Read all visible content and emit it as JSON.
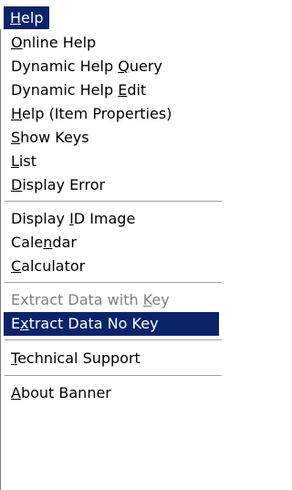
{
  "menu_title": "Help",
  "menu_title_mnemonic": "H",
  "items": [
    {
      "pre": "",
      "u": "O",
      "post": "nline Help",
      "state": "normal"
    },
    {
      "pre": "Dynamic Help ",
      "u": "Q",
      "post": "uery",
      "state": "normal"
    },
    {
      "pre": "Dynamic Help ",
      "u": "E",
      "post": "dit",
      "state": "normal"
    },
    {
      "pre": "",
      "u": "H",
      "post": "elp (Item Properties)",
      "state": "normal"
    },
    {
      "pre": "",
      "u": "S",
      "post": "how Keys",
      "state": "normal"
    },
    {
      "pre": "",
      "u": "L",
      "post": "ist",
      "state": "normal"
    },
    {
      "pre": "",
      "u": "D",
      "post": "isplay Error",
      "state": "normal"
    },
    {
      "pre": "Display ",
      "u": "I",
      "post": "D Image",
      "state": "normal"
    },
    {
      "pre": "Cale",
      "u": "n",
      "post": "dar",
      "state": "normal"
    },
    {
      "pre": "",
      "u": "C",
      "post": "alculator",
      "state": "normal"
    },
    {
      "pre": "Extract Data with ",
      "u": "K",
      "post": "ey",
      "state": "disabled"
    },
    {
      "pre": "E",
      "u": "x",
      "post": "tract Data No Key",
      "state": "highlighted"
    },
    {
      "pre": "",
      "u": "T",
      "post": "echnical Support",
      "state": "normal"
    },
    {
      "pre": "",
      "u": "A",
      "post": "bout Banner",
      "state": "normal"
    }
  ],
  "colors": {
    "highlight_bg": "#0a246a",
    "highlight_text": "#ffffff",
    "disabled_text": "#808080",
    "separator": "#a0a0a0"
  }
}
